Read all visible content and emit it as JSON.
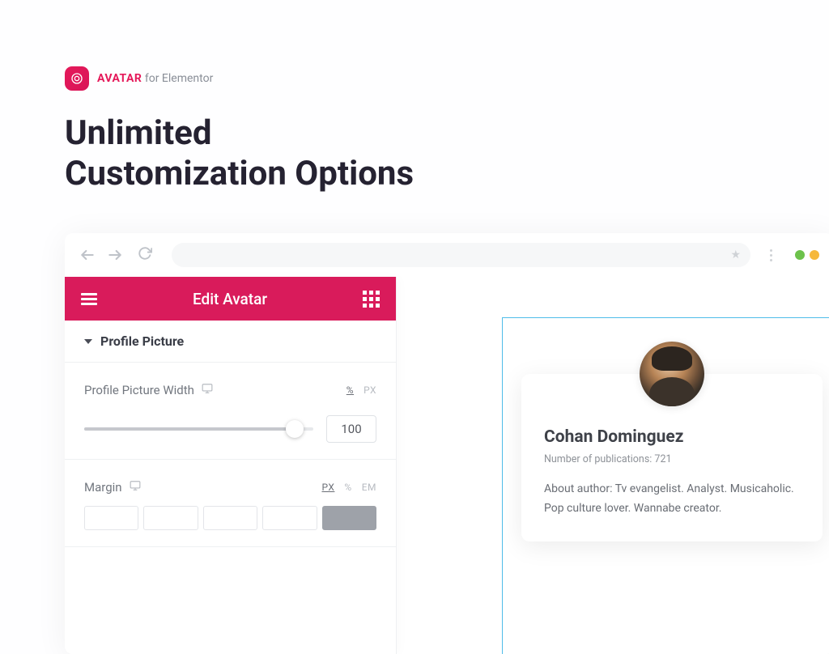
{
  "brand": {
    "strong": "AVATAR",
    "sub": " for Elementor"
  },
  "hero": {
    "line1": "Unlimited",
    "line2": "Customization Options"
  },
  "panel": {
    "title": "Edit Avatar",
    "section": "Profile Picture",
    "width_control": {
      "label": "Profile Picture Width",
      "unit_active": "%",
      "unit_other": "PX",
      "value": "100"
    },
    "margin_control": {
      "label": "Margin",
      "unit_active": "PX",
      "unit_b": "%",
      "unit_c": "EM"
    }
  },
  "preview": {
    "name": "Cohan Dominguez",
    "meta": "Number of publications: 721",
    "bio": "About author: Tv evangelist. Analyst. Musicaholic. Pop culture lover. Wannabe creator."
  }
}
